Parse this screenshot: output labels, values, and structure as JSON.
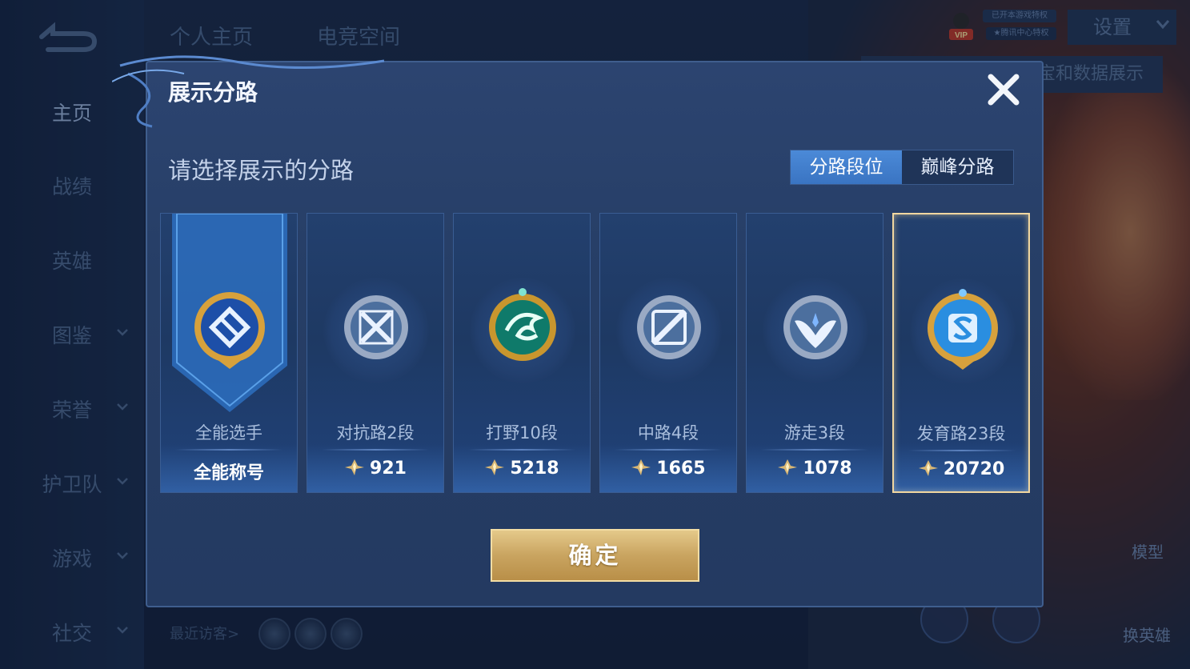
{
  "sidebar": {
    "items": [
      {
        "label": "主页",
        "active": true,
        "has_chevron": false
      },
      {
        "label": "战绩",
        "active": false,
        "has_chevron": false
      },
      {
        "label": "英雄",
        "active": false,
        "has_chevron": false
      },
      {
        "label": "图鉴",
        "active": false,
        "has_chevron": true
      },
      {
        "label": "荣誉",
        "active": false,
        "has_chevron": true
      },
      {
        "label": "护卫队",
        "active": false,
        "has_chevron": true
      },
      {
        "label": "游戏",
        "active": false,
        "has_chevron": true
      },
      {
        "label": "社交",
        "active": false,
        "has_chevron": true
      }
    ]
  },
  "header": {
    "tabs": [
      "个人主页",
      "电竞空间"
    ],
    "vip_label": "VIP",
    "rank_tag_1": "已开本游戏特权",
    "rank_tag_2": "★腾讯中心特权",
    "settings_label": "设置",
    "tooltip_text": "宝和数据展示"
  },
  "footer": {
    "visitors_label": "最近访客>",
    "model_label": "模型",
    "switch_hero_label": "换英雄"
  },
  "modal": {
    "title": "展示分路",
    "subtitle": "请选择展示的分路",
    "tabs": [
      {
        "label": "分路段位",
        "active": true
      },
      {
        "label": "巅峰分路",
        "active": false
      }
    ],
    "cards": [
      {
        "name": "全能选手",
        "value": "全能称号",
        "show_points_icon": false,
        "badge": "all-round-badge",
        "selected": false
      },
      {
        "name": "对抗路2段",
        "value": "921",
        "show_points_icon": true,
        "badge": "clash-lane-badge",
        "selected": false
      },
      {
        "name": "打野10段",
        "value": "5218",
        "show_points_icon": true,
        "badge": "jungle-badge",
        "selected": false
      },
      {
        "name": "中路4段",
        "value": "1665",
        "show_points_icon": true,
        "badge": "mid-lane-badge",
        "selected": false
      },
      {
        "name": "游走3段",
        "value": "1078",
        "show_points_icon": true,
        "badge": "roam-badge",
        "selected": false
      },
      {
        "name": "发育路23段",
        "value": "20720",
        "show_points_icon": true,
        "badge": "farm-lane-badge",
        "selected": true
      }
    ],
    "confirm_label": "确定"
  },
  "colors": {
    "accent_blue": "#3a74c2",
    "gold": "#c9a460",
    "selected_border": "#f1d7a0"
  }
}
